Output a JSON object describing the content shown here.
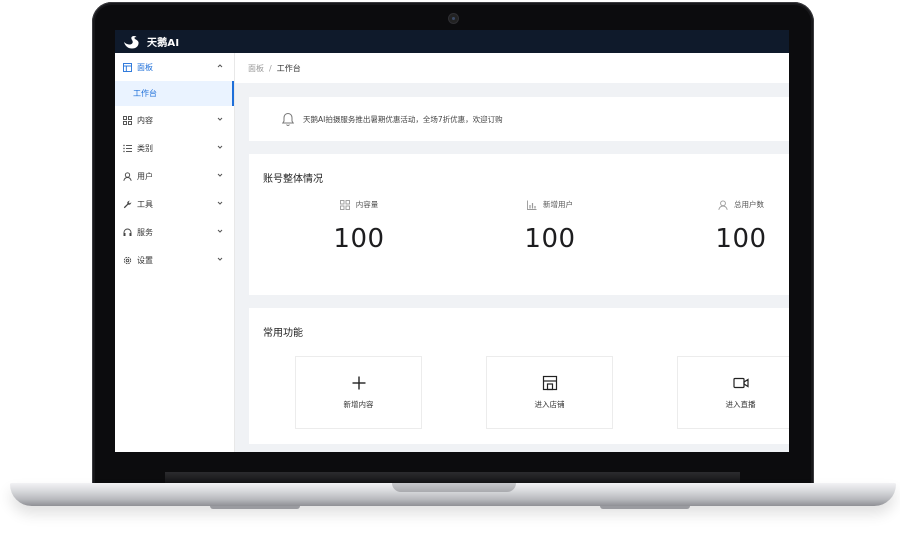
{
  "app": {
    "title": "天鹅AI"
  },
  "sidebar": {
    "items": [
      {
        "label": "面板",
        "icon": "dashboard-icon",
        "expanded": true
      },
      {
        "label": "内容",
        "icon": "grid-icon"
      },
      {
        "label": "类别",
        "icon": "list-icon"
      },
      {
        "label": "用户",
        "icon": "user-icon"
      },
      {
        "label": "工具",
        "icon": "wrench-icon"
      },
      {
        "label": "服务",
        "icon": "headset-icon"
      },
      {
        "label": "设置",
        "icon": "gear-icon"
      }
    ],
    "sub_item": {
      "label": "工作台",
      "active": true
    }
  },
  "breadcrumb": {
    "parent": "面板",
    "separator": "/",
    "current": "工作台"
  },
  "notice": {
    "text": "天鹅AI拍摄服务推出暑期优惠活动，全场7折优惠，欢迎订购",
    "icon": "bell-icon"
  },
  "stats": {
    "title": "账号整体情况",
    "items": [
      {
        "label": "内容量",
        "value": "100",
        "icon": "grid-icon"
      },
      {
        "label": "新增用户",
        "value": "100",
        "icon": "bar-chart-icon"
      },
      {
        "label": "总用户数",
        "value": "100",
        "icon": "user-icon"
      }
    ]
  },
  "functions": {
    "title": "常用功能",
    "items": [
      {
        "label": "新增内容",
        "icon": "plus-icon"
      },
      {
        "label": "进入店铺",
        "icon": "store-icon"
      },
      {
        "label": "进入直播",
        "icon": "video-icon"
      }
    ]
  },
  "colors": {
    "accent": "#1e6fd9",
    "topbar": "#0f1a2b",
    "background": "#f0f2f5",
    "active_bg": "#eaf3ff"
  }
}
